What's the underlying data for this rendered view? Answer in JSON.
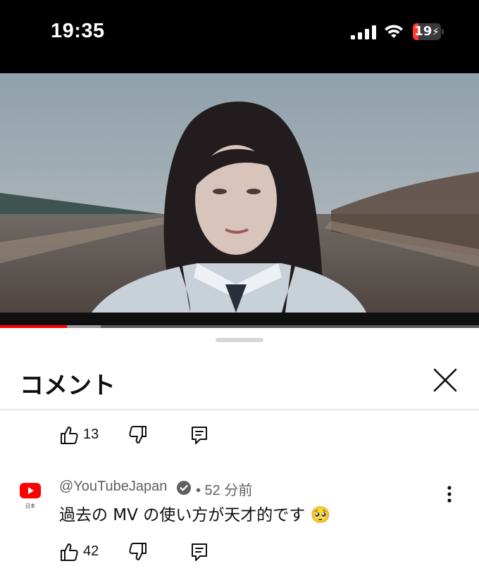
{
  "status_bar": {
    "time": "19:35",
    "battery_level": "19",
    "battery_charging": true,
    "battery_color": "#ff3b30"
  },
  "player": {
    "progress_played_fraction": 0.14,
    "progress_buffered_fraction": 0.21,
    "accent_color": "#ff0000"
  },
  "comments_panel": {
    "title": "コメント",
    "close_icon": "close-icon"
  },
  "previous_comment": {
    "like_count": "13"
  },
  "comment": {
    "channel_logo_caption": "日本",
    "author": "@YouTubeJapan",
    "time_ago": "• 52 分前",
    "text": "過去の MV の使い方が天才的です",
    "emoji": "🥺",
    "like_count": "42"
  }
}
